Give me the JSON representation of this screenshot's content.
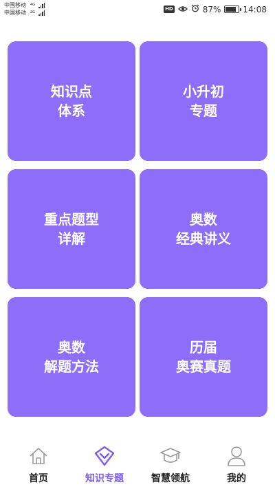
{
  "status_bar": {
    "carrier_1": "中国移动",
    "carrier_1_network": "4G",
    "carrier_2": "中国移动",
    "carrier_2_network": "2G",
    "hd_label": "HD",
    "battery_percent": "87%",
    "battery_level": 0.87,
    "time": "14:08"
  },
  "tiles": [
    {
      "line1": "知识点",
      "line2": "体系"
    },
    {
      "line1": "小升初",
      "line2": "专题"
    },
    {
      "line1": "重点题型",
      "line2": "详解"
    },
    {
      "line1": "奥数",
      "line2": "经典讲义"
    },
    {
      "line1": "奥数",
      "line2": "解题方法"
    },
    {
      "line1": "历届",
      "line2": "奥赛真题"
    }
  ],
  "nav": [
    {
      "label": "首页",
      "icon": "home-icon"
    },
    {
      "label": "知识专题",
      "icon": "topic-icon",
      "active": true
    },
    {
      "label": "智慧领航",
      "icon": "graduation-cap-icon"
    },
    {
      "label": "我的",
      "icon": "user-icon"
    }
  ],
  "colors": {
    "tile": "#8c6ef9",
    "nav_active": "#7d5cf2",
    "nav_inactive_icon": "#9a9a9a"
  }
}
